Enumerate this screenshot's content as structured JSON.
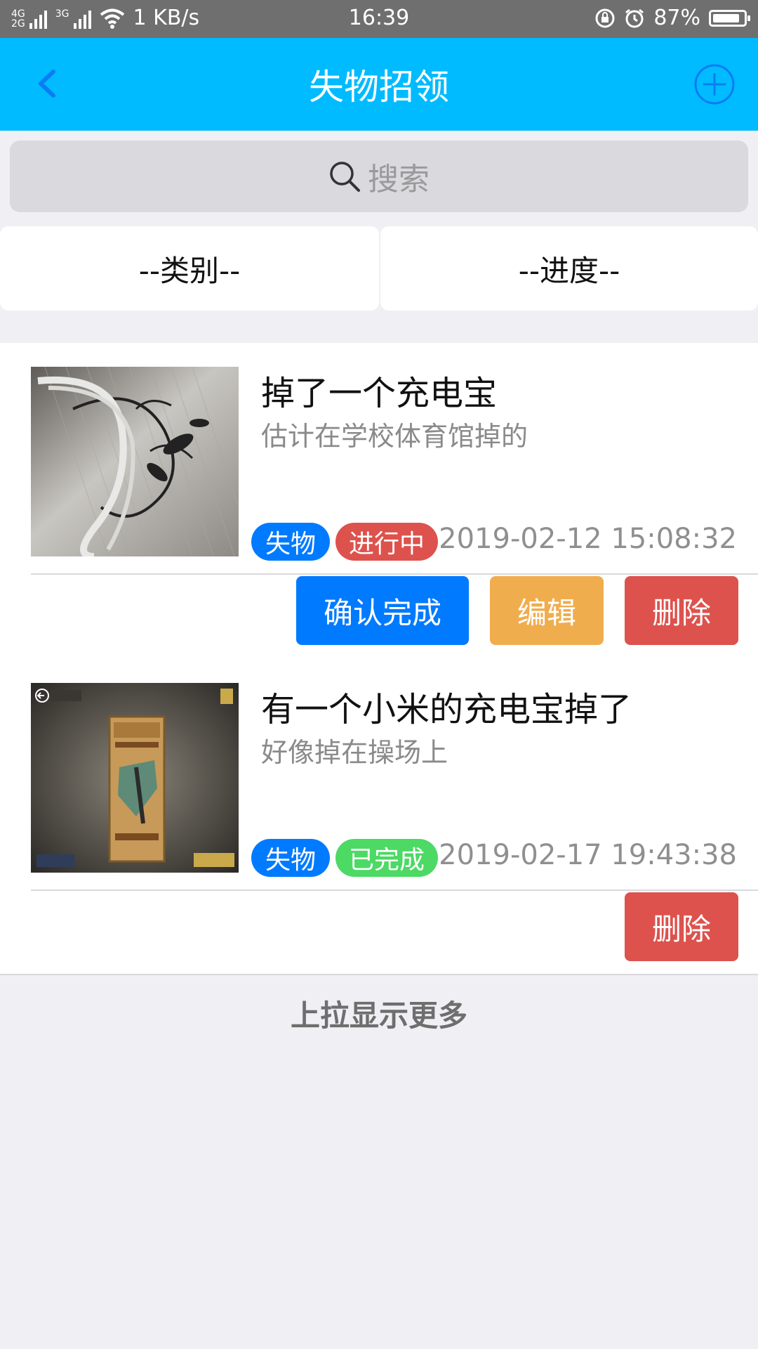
{
  "status_bar": {
    "net1": "4G",
    "net2": "2G",
    "net3": "3G",
    "speed": "1 KB/s",
    "time": "16:39",
    "battery_pct": "87%",
    "battery_level": 0.87
  },
  "header": {
    "title": "失物招领",
    "back_icon": "chevron-left-icon",
    "add_icon": "plus-circle-icon"
  },
  "search": {
    "placeholder": "搜索",
    "icon": "search-icon"
  },
  "filters": {
    "category": "--类别--",
    "progress": "--进度--"
  },
  "items": [
    {
      "title": "掉了一个充电宝",
      "description": "估计在学校体育馆掉的",
      "type_tag": "失物",
      "status_tag": "进行中",
      "datetime": "2019-02-12 15:08:32",
      "actions": [
        "确认完成",
        "编辑",
        "删除"
      ]
    },
    {
      "title": "有一个小米的充电宝掉了",
      "description": "好像掉在操场上",
      "type_tag": "失物",
      "status_tag": "已完成",
      "datetime": "2019-02-17 19:43:38",
      "actions": [
        "删除"
      ]
    }
  ],
  "footer": {
    "load_more": "上拉显示更多"
  },
  "colors": {
    "nav_bg": "#00bbff",
    "primary": "#007aff",
    "warning": "#f0ad4e",
    "danger": "#dd524d",
    "success": "#4cd964"
  }
}
